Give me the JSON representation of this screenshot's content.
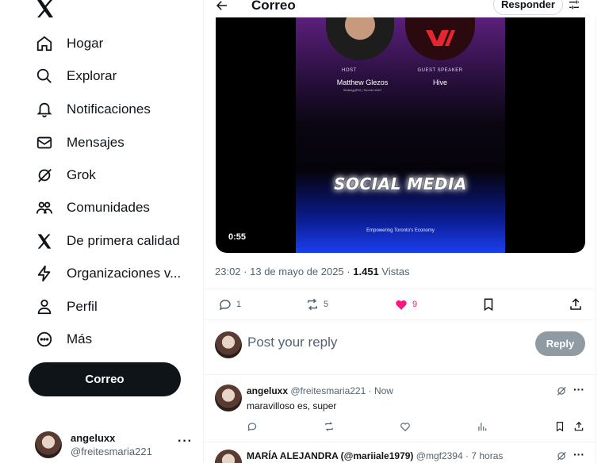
{
  "sidebar": {
    "logo": "x-logo-icon",
    "items": [
      {
        "label": "Hogar",
        "icon": "home-icon"
      },
      {
        "label": "Explorar",
        "icon": "search-icon"
      },
      {
        "label": "Notificaciones",
        "icon": "bell-icon"
      },
      {
        "label": "Mensajes",
        "icon": "mail-icon"
      },
      {
        "label": "Grok",
        "icon": "grok-icon"
      },
      {
        "label": "Comunidades",
        "icon": "communities-icon"
      },
      {
        "label": "De primera calidad",
        "icon": "x-premium-icon"
      },
      {
        "label": "Organizaciones v...",
        "icon": "lightning-icon"
      },
      {
        "label": "Perfil",
        "icon": "person-icon"
      },
      {
        "label": "Más",
        "icon": "more-circle-icon"
      }
    ],
    "post_button": "Correo",
    "account": {
      "name": "angeluxx",
      "handle": "@freitesmaria221",
      "more": "···"
    }
  },
  "header": {
    "title": "Correo",
    "reply_chip": "Responder"
  },
  "video": {
    "host_label": "HOST",
    "host_name": "Matthew Glezos",
    "host_sub": "Strategy|PM | Toronto DAO",
    "guest_label": "GUEST SPEAKER",
    "guest_name": "Hive",
    "headline": "SOCIAL MEDIA",
    "footer": "Empowering Toronto's Economy",
    "duration": "0:55"
  },
  "post_meta": {
    "time": "23:02",
    "date": "13 de mayo de 2025",
    "views_count": "1.451",
    "views_label": "Vistas"
  },
  "actions": {
    "replies": "1",
    "reposts": "5",
    "likes": "9",
    "like_color": "#f91880"
  },
  "compose": {
    "placeholder": "Post your reply",
    "button": "Reply"
  },
  "replies": [
    {
      "name": "angeluxx",
      "handle": "@freitesmaria221",
      "time": "Now",
      "text": "maravilloso es, super"
    },
    {
      "name": "MARÍA ALEJANDRA (@mariiale1979)",
      "handle": "@mgf2394",
      "time": "7 horas",
      "text": ""
    }
  ]
}
